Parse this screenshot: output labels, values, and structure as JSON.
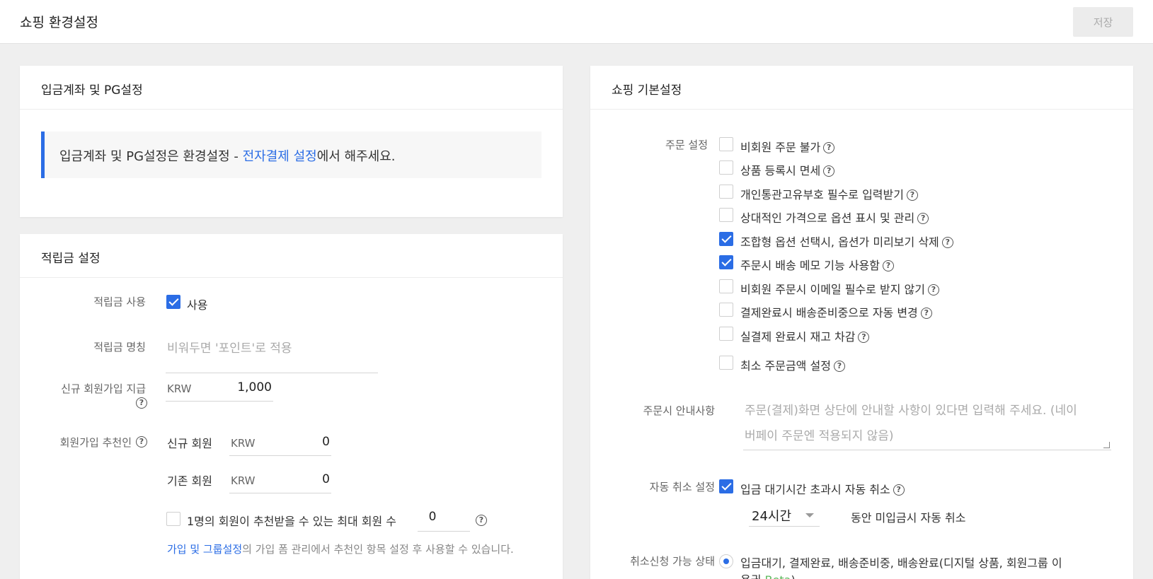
{
  "header": {
    "title": "쇼핑 환경설정",
    "save_label": "저장"
  },
  "pg_card": {
    "title": "입금계좌 및 PG설정",
    "notice_prefix": "입금계좌 및 PG설정은 환경설정 - ",
    "notice_link": "전자결제 설정",
    "notice_suffix": "에서 해주세요."
  },
  "point_card": {
    "title": "적립금 설정",
    "use_label": "적립금 사용",
    "use_checkbox_label": "사용",
    "use_checked": true,
    "name_label": "적립금 명칭",
    "name_placeholder": "비워두면 '포인트'로 적용",
    "signup_label": "신규 회원가입 지급",
    "signup_unit": "KRW",
    "signup_value": "1,000",
    "referrer_label": "회원가입 추천인",
    "new_member_label": "신규 회원",
    "new_member_unit": "KRW",
    "new_member_value": "0",
    "existing_member_label": "기존 회원",
    "existing_member_unit": "KRW",
    "existing_member_value": "0",
    "max_ref_label": "1명의 회원이 추천받을 수 있는 최대 회원 수",
    "max_ref_value": "0",
    "max_ref_checked": false,
    "footer_link": "가입 및 그룹설정",
    "footer_text": "의 가입 폼 관리에서 추천인 항목 설정 후 사용할 수 있습니다."
  },
  "shop_card": {
    "title": "쇼핑 기본설정",
    "order_label": "주문 설정",
    "order_options": [
      {
        "label": "비회원 주문 불가",
        "checked": false
      },
      {
        "label": "상품 등록시 면세",
        "checked": false
      },
      {
        "label": "개인통관고유부호 필수로 입력받기",
        "checked": false
      },
      {
        "label": "상대적인 가격으로 옵션 표시 및 관리",
        "checked": false
      },
      {
        "label": "조합형 옵션 선택시, 옵션가 미리보기 삭제",
        "checked": true
      },
      {
        "label": "주문시 배송 메모 기능 사용함",
        "checked": true
      },
      {
        "label": "비회원 주문시 이메일 필수로 받지 않기",
        "checked": false
      },
      {
        "label": "결제완료시 배송준비중으로 자동 변경",
        "checked": false
      },
      {
        "label": "실결제 완료시 재고 차감",
        "checked": false
      },
      {
        "label": "최소 주문금액 설정",
        "checked": false
      }
    ],
    "notice_label": "주문시 안내사항",
    "notice_placeholder_line1": "주문(결제)화면 상단에 안내할 사항이 있다면 입력해 주세요. (네이",
    "notice_placeholder_line2": "버페이 주문엔 적용되지 않음)",
    "auto_cancel_label": "자동 취소 설정",
    "auto_cancel_option": "입금 대기시간 초과시 자동 취소",
    "auto_cancel_checked": true,
    "auto_cancel_hours": "24시간",
    "auto_cancel_suffix": "동안 미입금시 자동 취소",
    "cancel_status_label": "취소신청 가능 상태",
    "cancel_status_option_line1": "입금대기, 결제완료, 배송준비중, 배송완료(디지털 상품, 회원그룹 이",
    "cancel_status_option_line2": "용권",
    "beta_label": "Beta",
    "cancel_status_close": ")"
  },
  "icons": {
    "help": "question-circle-icon",
    "check": "check-icon",
    "caret": "caret-down-icon"
  },
  "colors": {
    "accent": "#2b6de5",
    "beta": "#5cb85c",
    "background": "#efefef"
  }
}
